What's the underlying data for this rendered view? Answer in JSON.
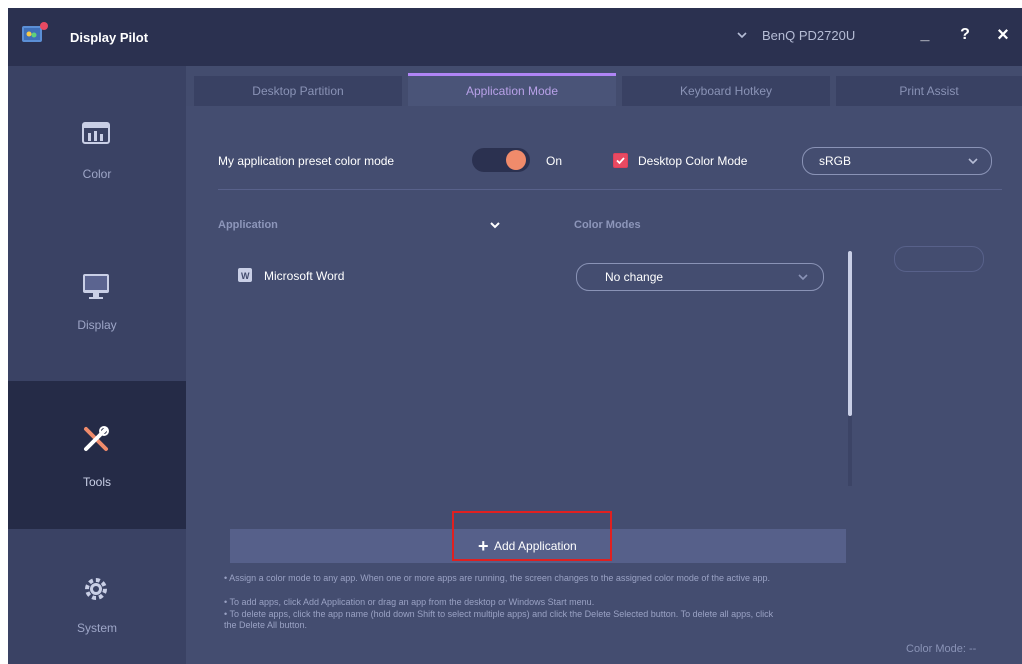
{
  "titlebar": {
    "app_title": "Display Pilot",
    "monitor": "BenQ PD2720U",
    "minimize_label": "_",
    "help_label": "?",
    "close_label": "×"
  },
  "sidebar": {
    "items": [
      {
        "label": "Color",
        "icon": "color-bars-icon"
      },
      {
        "label": "Display",
        "icon": "monitor-icon"
      },
      {
        "label": "Tools",
        "icon": "tools-icon",
        "active": true
      },
      {
        "label": "System",
        "icon": "gear-icon"
      }
    ]
  },
  "tabs": [
    {
      "label": "Desktop Partition"
    },
    {
      "label": "Application Mode",
      "active": true
    },
    {
      "label": "Keyboard Hotkey"
    },
    {
      "label": "Print Assist"
    }
  ],
  "preset": {
    "label": "My application preset color mode",
    "toggle_state": "On",
    "desktop_color_mode_label": "Desktop Color Mode",
    "desktop_color_mode_checked": true,
    "desktop_color_mode_value": "sRGB"
  },
  "table": {
    "col_application": "Application",
    "col_color_modes": "Color Modes",
    "rows": [
      {
        "app": "Microsoft Word",
        "color_mode": "No change"
      }
    ]
  },
  "add_button": {
    "plus": "+",
    "label": "Add Application"
  },
  "hints": [
    "• Assign a color mode to any app. When one or more apps are running, the screen changes to the assigned color mode of the active app.",
    "• To add apps, click Add Application or drag an app from the desktop or Windows Start menu.",
    "• To delete apps, click the app name (hold down Shift to select multiple apps) and click the Delete Selected button. To delete all apps, click the Delete All button."
  ],
  "status": {
    "color_mode": "Color Mode: --"
  },
  "colors": {
    "window_bg": "#434c6e",
    "titlebar_bg": "#2b3150",
    "sidebar_bg": "#3a4264",
    "active_tab_accent": "#b085f5",
    "toggle_knob": "#f08b6b",
    "checkbox": "#e84a62",
    "highlight_box": "#e02020"
  }
}
